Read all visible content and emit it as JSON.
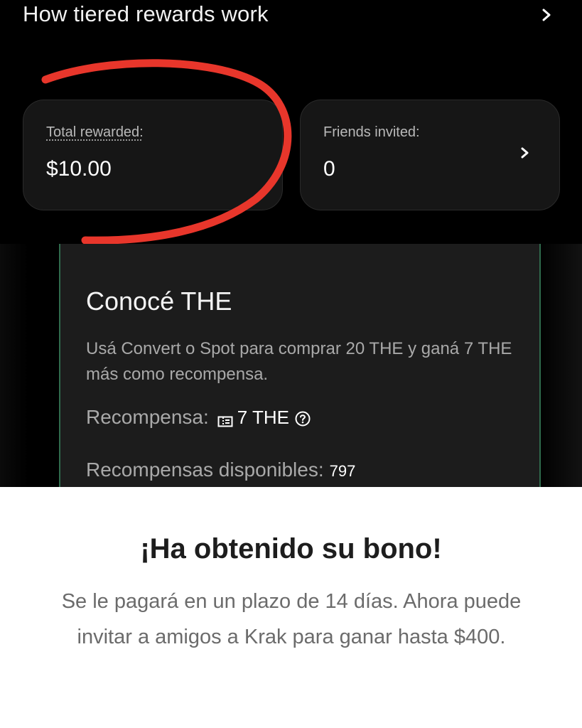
{
  "header": {
    "title": "How tiered rewards work",
    "chevron_icon": "chevron-right-icon"
  },
  "stats": {
    "total_rewarded_label": "Total rewarded:",
    "total_rewarded_value": "$10.00",
    "friends_invited_label": "Friends invited:",
    "friends_invited_value": "0"
  },
  "annotation": {
    "color": "#e8362b"
  },
  "promo": {
    "title": "Conocé THE",
    "description": "Usá Convert o Spot para comprar 20 THE y ganá 7 THE más como recompensa.",
    "reward_label": "Recompensa:",
    "reward_value": "7 THE",
    "available_label": "Recompensas disponibles:",
    "available_count": "797",
    "accent_color": "#2f6a4c"
  },
  "bonus": {
    "title": "¡Ha obtenido su bono!",
    "message": "Se le pagará en un plazo de 14 días. Ahora puede invitar a amigos a Krak para ganar hasta $400."
  }
}
